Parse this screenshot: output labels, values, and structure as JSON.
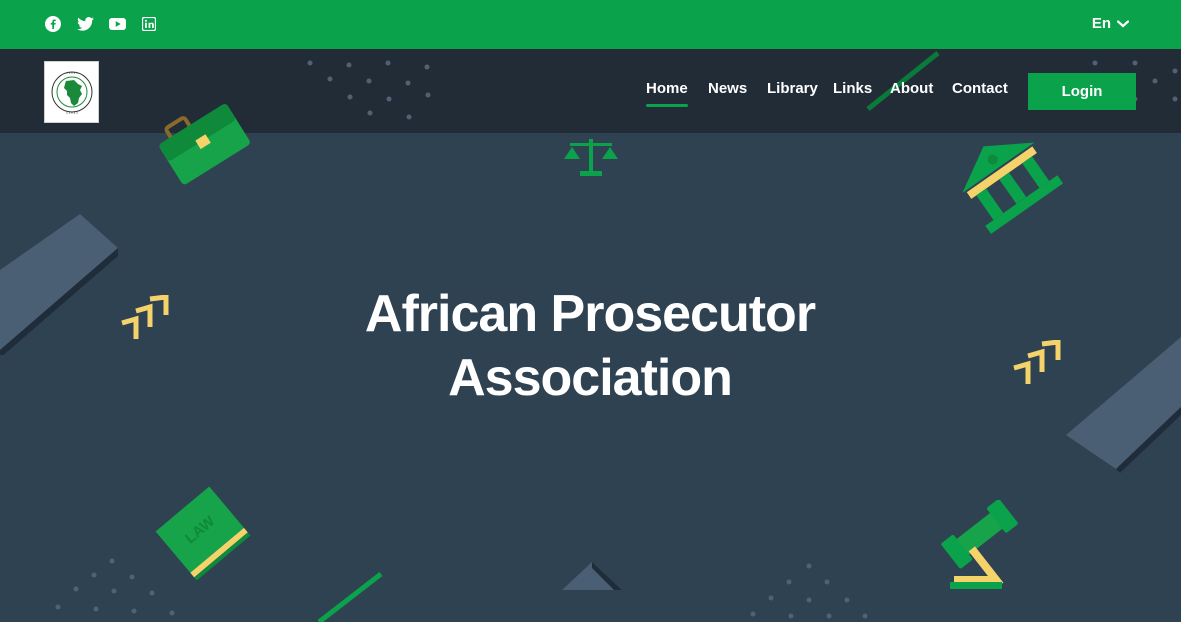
{
  "topbar": {
    "social_icons": [
      "facebook-icon",
      "twitter-icon",
      "youtube-icon",
      "linkedin-icon"
    ],
    "language": "En"
  },
  "header": {
    "logo": "african-prosecutors-association-logo",
    "nav": [
      {
        "label": "Home",
        "active": true
      },
      {
        "label": "News"
      },
      {
        "label": "Library"
      },
      {
        "label": "Links"
      },
      {
        "label": "About"
      },
      {
        "label": "Contact"
      }
    ],
    "login_label": "Login"
  },
  "hero": {
    "title_line1": "African Prosecutor",
    "title_line2": "Association",
    "book_label": "LAW"
  },
  "colors": {
    "brand_green": "#0aa24b",
    "navbar": "#222c37",
    "hero_bg": "#2f4252",
    "accent_yellow": "#f5d36b"
  }
}
